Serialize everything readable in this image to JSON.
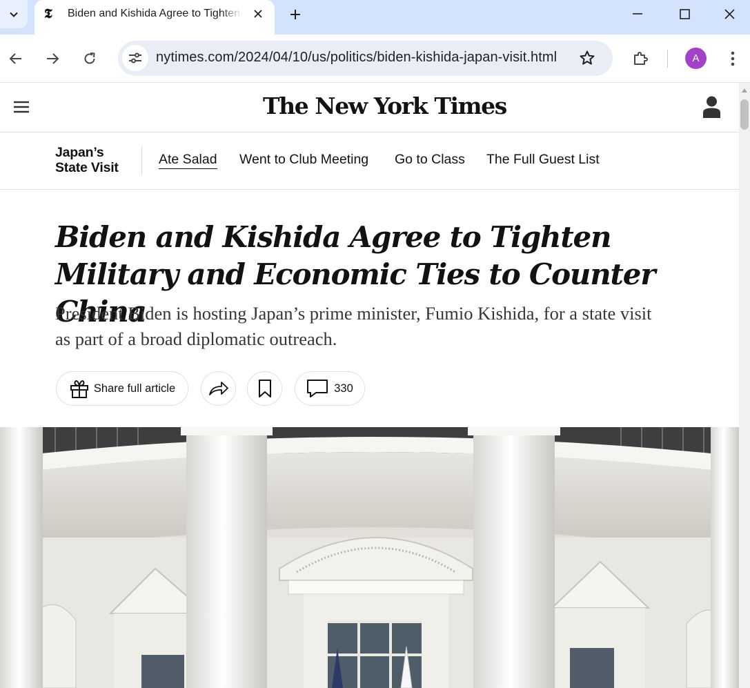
{
  "browser": {
    "tab": {
      "title": "Biden and Kishida Agree to Tighten Military and Economic Ties to Counter China",
      "favicon": "nyt-t-icon"
    },
    "url": "nytimes.com/2024/04/10/us/politics/biden-kishida-japan-visit.html",
    "profile_initial": "A",
    "colors": {
      "tabbar": "#d3e3fd",
      "omnibox": "#e9eef6",
      "avatar": "#a142c9"
    }
  },
  "masthead": {
    "logo": "The New York Times"
  },
  "subnav": {
    "series_title": "Japan’s State Visit",
    "links": [
      {
        "label": "Ate Salad",
        "active": true
      },
      {
        "label": "Went to Club Meeting",
        "active": false
      },
      {
        "label": "Go to Class",
        "active": false
      },
      {
        "label": "The Full Guest List",
        "active": false
      }
    ]
  },
  "article": {
    "headline": "Biden and Kishida Agree to Tighten Military and Economic Ties to Counter China",
    "summary": "President Biden is hosting Japan’s prime minister, Fumio Kishida, for a state visit as part of a broad diplomatic outreach.",
    "actions": {
      "share_label": "Share full article",
      "comments_count": "330"
    }
  }
}
